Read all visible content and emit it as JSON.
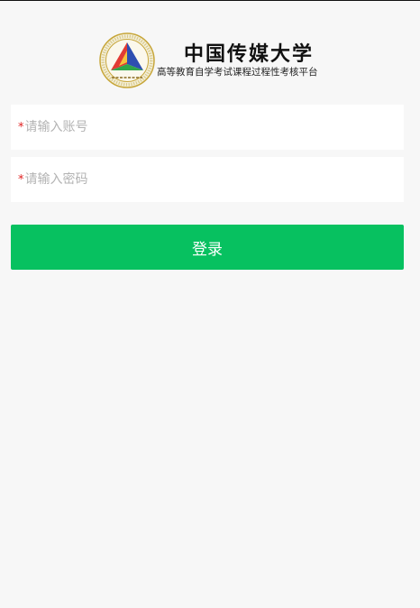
{
  "header": {
    "brand_title": "中国传媒大学",
    "brand_subtitle": "高等教育自学考试课程过程性考核平台"
  },
  "form": {
    "account": {
      "required_mark": "*",
      "placeholder": "请输入账号",
      "value": ""
    },
    "password": {
      "required_mark": "*",
      "placeholder": "请输入密码",
      "value": ""
    },
    "login_label": "登录"
  },
  "colors": {
    "page_background": "#f7f7f7",
    "button": "#07c160",
    "required": "#e02020",
    "placeholder": "#b3b3b3"
  },
  "icons": {
    "logo": "university-seal-logo"
  }
}
